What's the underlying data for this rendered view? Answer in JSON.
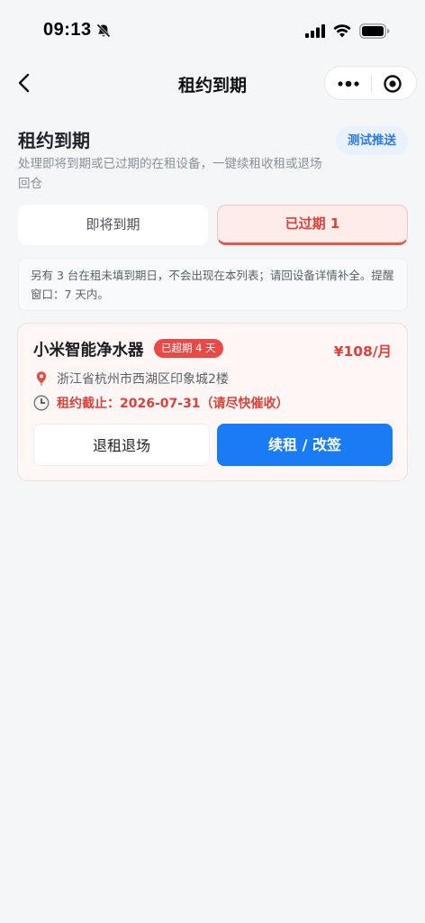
{
  "status_bar": {
    "time": "09:13"
  },
  "nav": {
    "title": "租约到期"
  },
  "header": {
    "title": "租约到期",
    "description": "处理即将到期或已过期的在租设备，一键续租收租或退场回仓",
    "test_push_label": "测试推送"
  },
  "tabs": [
    {
      "label": "即将到期",
      "active": false
    },
    {
      "label": "已过期 1",
      "active": true
    }
  ],
  "notice": {
    "text": "另有 3 台在租未填到期日，不会出现在本列表；请回设备详情补全。提醒窗口：7 天内。"
  },
  "card": {
    "title": "小米智能净水器",
    "badge": "已超期 4 天",
    "price": "¥108/月",
    "address": "浙江省杭州市西湖区印象城2楼",
    "deadline": "租约截止：2026-07-31（请尽快催收）",
    "return_button": "退租退场",
    "renew_button": "续租 / 改签"
  },
  "colors": {
    "accent_blue": "#1a7cf5",
    "danger_red": "#e0403a",
    "badge_red": "#e84a45",
    "card_bg": "#fff7f6",
    "page_bg": "#f5f6f8"
  },
  "icons": {
    "status": [
      "bell-slash-icon",
      "signal-icon",
      "wifi-icon",
      "battery-icon"
    ],
    "nav": [
      "back-icon",
      "more-icon",
      "target-icon"
    ],
    "card": [
      "location-pin-icon",
      "clock-icon"
    ]
  }
}
